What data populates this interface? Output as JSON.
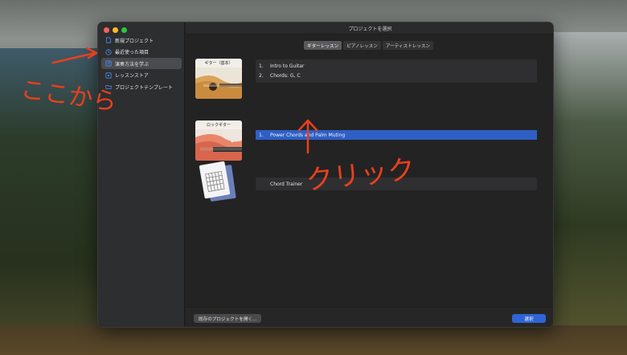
{
  "window": {
    "title": "プロジェクトを選択"
  },
  "sidebar": {
    "items": [
      {
        "label": "新規プロジェクト",
        "icon": "document-icon",
        "selected": false
      },
      {
        "label": "最近使った項目",
        "icon": "clock-icon",
        "selected": false
      },
      {
        "label": "演奏方法を学ぶ",
        "icon": "music-note-icon",
        "selected": true
      },
      {
        "label": "レッスンストア",
        "icon": "store-icon",
        "selected": false
      },
      {
        "label": "プロジェクトテンプレート",
        "icon": "folder-icon",
        "selected": false
      }
    ]
  },
  "tabs": [
    {
      "label": "ギターレッスン",
      "active": true
    },
    {
      "label": "ピアノレッスン",
      "active": false
    },
    {
      "label": "アーティストレッスン",
      "active": false
    }
  ],
  "lessons": [
    {
      "card_title": "ギター（基本）",
      "items": [
        {
          "num": "1.",
          "title": "Intro to Guitar"
        },
        {
          "num": "2.",
          "title": "Chords: G, C"
        }
      ]
    },
    {
      "card_title": "ロックギター",
      "items": [
        {
          "num": "1.",
          "title": "Power Chords and Palm Muting"
        }
      ]
    },
    {
      "items": [
        {
          "num": "",
          "title": "Chord Trainer"
        }
      ]
    }
  ],
  "footer": {
    "open_existing": "既存のプロジェクトを開く...",
    "select": "選択"
  },
  "annotations": {
    "from_here": "ここから",
    "click": "クリック",
    "color": "#e8401e"
  },
  "colors": {
    "accent": "#2f64d6",
    "selection_row": "#2f5fc4"
  }
}
